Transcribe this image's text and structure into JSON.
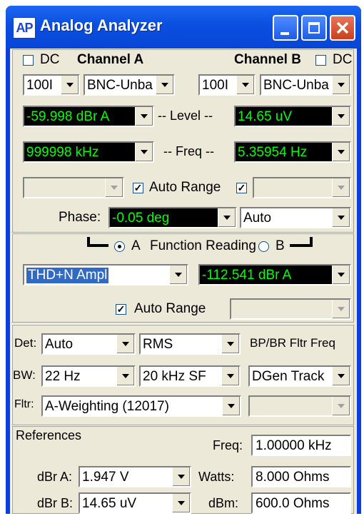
{
  "window": {
    "title": "Analog Analyzer",
    "logo": "AP"
  },
  "channels": {
    "dc_label_a": "DC",
    "channel_a_label": "Channel A",
    "channel_b_label": "Channel B",
    "dc_label_b": "DC",
    "a_range": "100I",
    "a_conn": "BNC-Unba",
    "b_range": "100I",
    "b_conn": "BNC-Unba",
    "level_label": "-- Level --",
    "a_level": "-59.998  dBr A",
    "b_level": "14.65   uV",
    "freq_label": "-- Freq --",
    "a_freq": "999998 kHz",
    "b_freq": "5.35954  Hz",
    "auto_range_label": "Auto Range"
  },
  "phase": {
    "label": "Phase:",
    "value": "-0.05   deg",
    "mode": "Auto"
  },
  "function": {
    "radio_a": "A",
    "reading_label": "Function Reading",
    "radio_b": "B",
    "measurement": "THD+N Ampl",
    "reading": "-112.541 dBr A",
    "auto_range_label": "Auto Range"
  },
  "filters": {
    "det_label": "Det:",
    "det_value": "Auto",
    "rms_value": "RMS",
    "bp_label": "BP/BR Fltr Freq",
    "bw_label": "BW:",
    "bw_value": "22 Hz",
    "bw_hi": "20 kHz SF",
    "dgen": "DGen Track",
    "fltr_label": "Fltr:",
    "fltr_value": "A-Weighting  (12017)"
  },
  "references": {
    "title": "References",
    "freq_label": "Freq:",
    "freq_value": "1.00000 kHz",
    "dbra_label": "dBr A:",
    "dbra_value": "1.947    V",
    "watts_label": "Watts:",
    "watts_value": "8.000     Ohms",
    "dbrb_label": "dBr B:",
    "dbrb_value": "14.65   uV",
    "dbm_label": "dBm:",
    "dbm_value": "600.0     Ohms"
  },
  "colors": {
    "title_bar": "#0a4fe0",
    "readout_bg": "#000000",
    "readout_fg": "#00ff00",
    "selection": "#316ac5"
  }
}
